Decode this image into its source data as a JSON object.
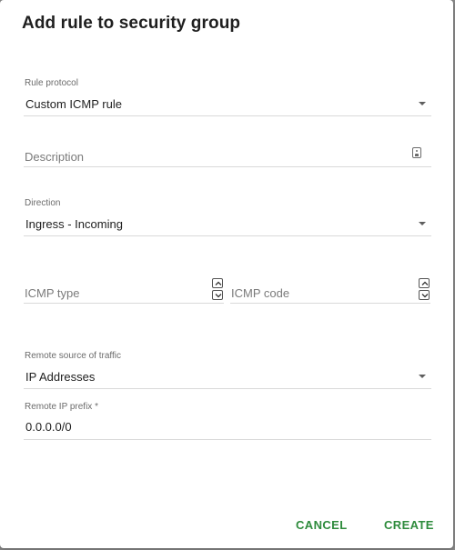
{
  "dialog": {
    "title": "Add rule to security group"
  },
  "rule_protocol": {
    "label": "Rule protocol",
    "value": "Custom ICMP rule",
    "icon": "chevron-down-icon"
  },
  "description": {
    "placeholder": "Description",
    "value": "",
    "icon": "contact-card-icon"
  },
  "direction": {
    "label": "Direction",
    "value": "Ingress - Incoming",
    "icon": "chevron-down-icon"
  },
  "icmp_type": {
    "placeholder": "ICMP type",
    "value": ""
  },
  "icmp_code": {
    "placeholder": "ICMP code",
    "value": ""
  },
  "remote_source": {
    "label": "Remote source of traffic",
    "value": "IP Addresses",
    "icon": "chevron-down-icon"
  },
  "remote_ip_prefix": {
    "label": "Remote IP prefix *",
    "value": "0.0.0.0/0"
  },
  "actions": {
    "cancel_label": "CANCEL",
    "create_label": "CREATE"
  },
  "colors": {
    "accent": "#2e8b3c",
    "overlay": "#8a8a8a",
    "divider": "#d9d9d9"
  }
}
